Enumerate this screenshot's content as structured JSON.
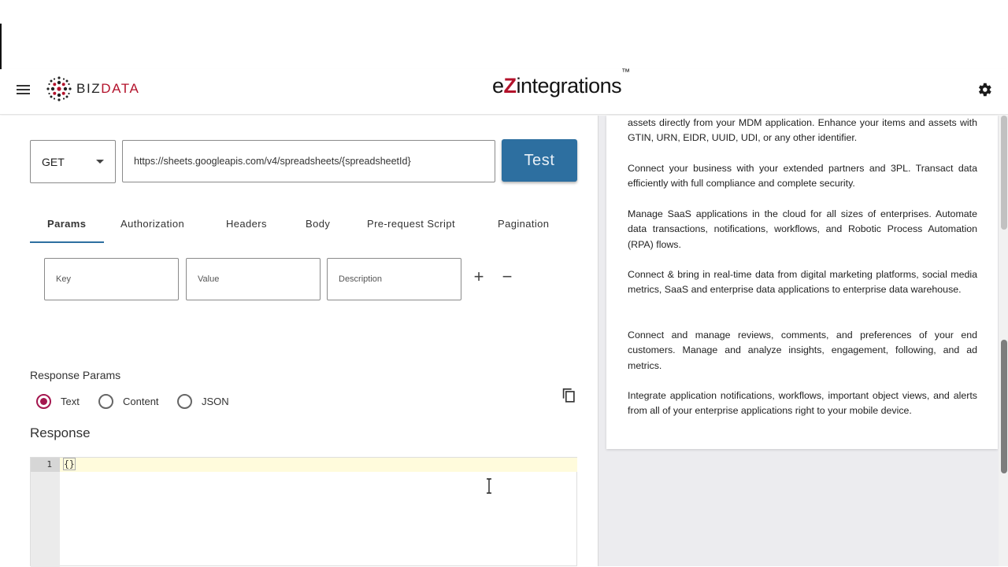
{
  "header": {
    "logo_biz": "BIZ",
    "logo_data": "DATA",
    "brand_e": "e",
    "brand_z": "Z",
    "brand_rest": "integrations",
    "brand_tm": "™"
  },
  "request": {
    "method": "GET",
    "url": "https://sheets.googleapis.com/v4/spreadsheets/{spreadsheetId}",
    "test_label": "Test"
  },
  "tabs": [
    {
      "label": "Params",
      "active": true
    },
    {
      "label": "Authorization"
    },
    {
      "label": "Headers"
    },
    {
      "label": "Body"
    },
    {
      "label": "Pre-request Script"
    },
    {
      "label": "Pagination"
    }
  ],
  "params": {
    "key_placeholder": "Key",
    "value_placeholder": "Value",
    "description_placeholder": "Description",
    "add": "+",
    "remove": "−"
  },
  "response_params": {
    "title": "Response Params",
    "options": [
      "Text",
      "Content",
      "JSON"
    ],
    "selected": "Text"
  },
  "response": {
    "title": "Response",
    "line_number": "1",
    "code": "{}"
  },
  "info_panel": [
    "assets directly from your MDM application. Enhance your items and assets with GTIN, URN, EIDR, UUID, UDI, or any other identifier.",
    "Connect your business with your extended partners and 3PL. Transact data efficiently with full compliance and complete security.",
    "Manage SaaS applications in the cloud for all sizes of enterprises. Automate data transactions, notifications, workflows, and Robotic Process Automation (RPA) flows.",
    "Connect & bring in real-time data from digital marketing platforms, social media metrics, SaaS and enterprise data applications to enterprise data warehouse.",
    "Connect and manage reviews, comments, and preferences of your end customers. Manage and analyze insights, engagement, following, and ad metrics.",
    "Integrate application notifications, workflows, important object views, and alerts from all of your enterprise applications right to your mobile device."
  ],
  "colors": {
    "accent_blue": "#2d6fa0",
    "brand_red": "#b3122b",
    "radio_selected": "#a4174f"
  }
}
